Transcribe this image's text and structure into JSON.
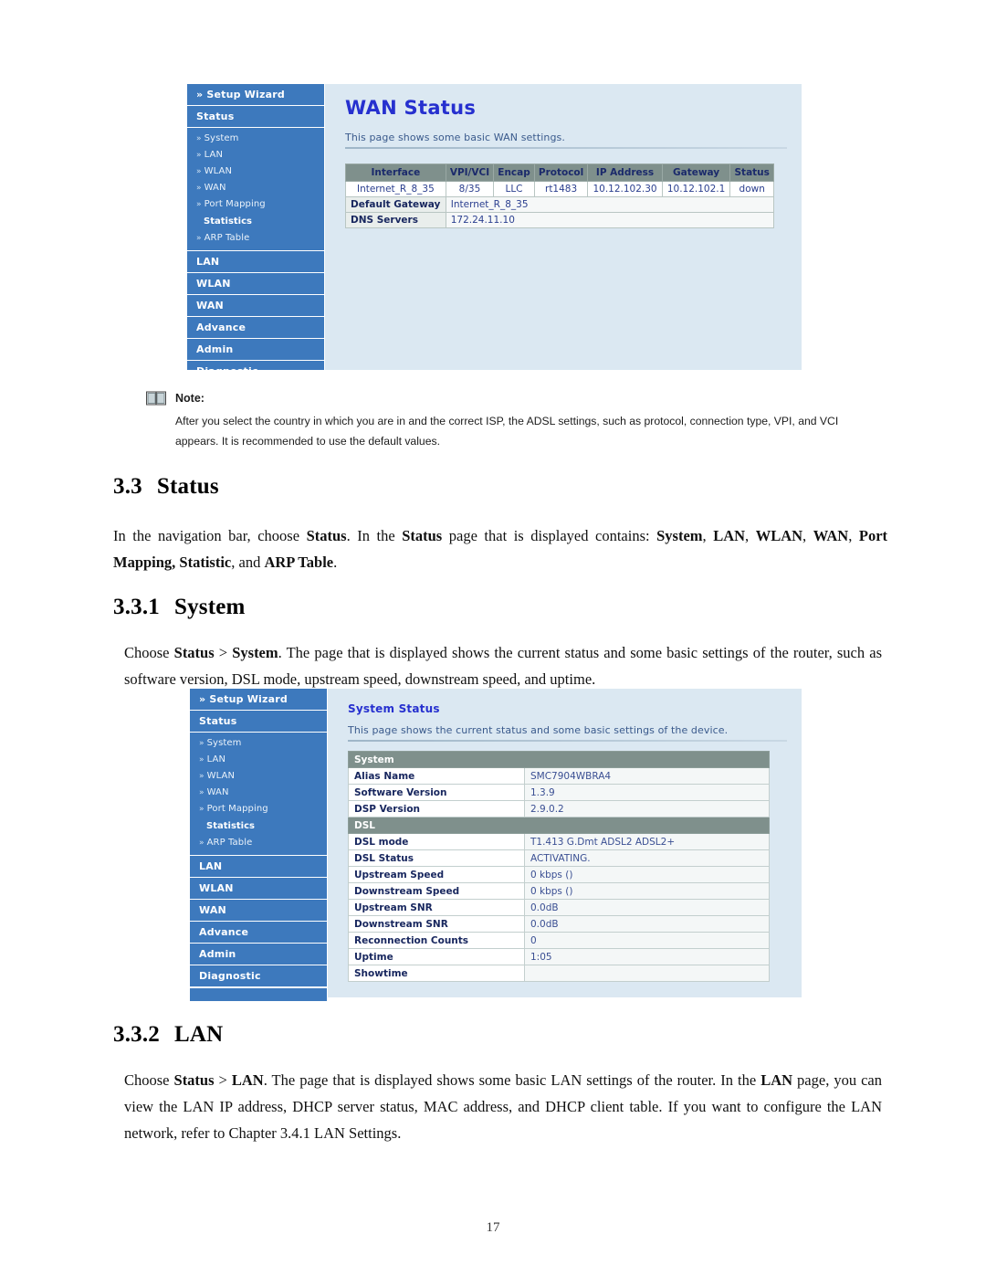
{
  "page": {
    "number": "17"
  },
  "sidebar": {
    "setup_wizard": "Setup Wizard",
    "status": "Status",
    "sub_items": [
      {
        "label": "System",
        "marker": "»"
      },
      {
        "label": "LAN",
        "marker": "»"
      },
      {
        "label": "WLAN",
        "marker": "»"
      },
      {
        "label": "WAN",
        "marker": "»"
      },
      {
        "label": "Port Mapping",
        "marker": "»"
      }
    ],
    "group_label": "Statistics",
    "arp_table": {
      "label": "ARP Table",
      "marker": "»"
    },
    "sections": [
      "LAN",
      "WLAN",
      "WAN",
      "Advance",
      "Admin",
      "Diagnostic"
    ],
    "chevron": "»"
  },
  "wan_panel": {
    "title": "WAN Status",
    "description": "This page shows some basic WAN settings.",
    "table": {
      "headers": [
        "Interface",
        "VPI/VCI",
        "Encap",
        "Protocol",
        "IP Address",
        "Gateway",
        "Status"
      ],
      "rows": [
        [
          "Internet_R_8_35",
          "8/35",
          "LLC",
          "rt1483",
          "10.12.102.30",
          "10.12.102.1",
          "down"
        ]
      ],
      "default_gateway_label": "Default Gateway",
      "default_gateway_value": "Internet_R_8_35",
      "dns_servers_label": "DNS Servers",
      "dns_servers_value": "172.24.11.10"
    }
  },
  "note": {
    "title": "Note:",
    "text": "After you select the country in which you are in and the correct ISP, the ADSL settings, such as protocol, connection type, VPI, and VCI appears. It is recommended to use the default values."
  },
  "section_33": {
    "number": "3.3",
    "title": "Status",
    "paragraph_parts": [
      {
        "t": "In the navigation bar, choose ",
        "b": false
      },
      {
        "t": "Status",
        "b": true
      },
      {
        "t": ". In the ",
        "b": false
      },
      {
        "t": "Status",
        "b": true
      },
      {
        "t": " page that is displayed contains: ",
        "b": false
      },
      {
        "t": "System",
        "b": true
      },
      {
        "t": ", ",
        "b": false
      },
      {
        "t": "LAN",
        "b": true
      },
      {
        "t": ", ",
        "b": false
      },
      {
        "t": "WLAN",
        "b": true
      },
      {
        "t": ", ",
        "b": false
      },
      {
        "t": "WAN",
        "b": true
      },
      {
        "t": ", ",
        "b": false
      },
      {
        "t": "Port Mapping, Statistic",
        "b": true
      },
      {
        "t": ", and ",
        "b": false
      },
      {
        "t": "ARP Table",
        "b": true
      },
      {
        "t": ".",
        "b": false
      }
    ]
  },
  "section_331": {
    "number": "3.3.1",
    "title": "System",
    "paragraph_parts": [
      {
        "t": "Choose ",
        "b": false
      },
      {
        "t": "Status",
        "b": true
      },
      {
        "t": " > ",
        "b": false
      },
      {
        "t": "System",
        "b": true
      },
      {
        "t": ". The page that is displayed shows the current status and some basic settings of the router, such as software version, DSL mode, upstream speed, downstream speed, and uptime.",
        "b": false
      }
    ]
  },
  "system_panel": {
    "title": "System Status",
    "description": "This page shows the current status and some basic settings of the device.",
    "rows": [
      {
        "type": "section",
        "label": "System",
        "value": ""
      },
      {
        "type": "data",
        "label": "Alias Name",
        "value": "SMC7904WBRA4"
      },
      {
        "type": "data",
        "label": "Software Version",
        "value": "1.3.9"
      },
      {
        "type": "data",
        "label": "DSP Version",
        "value": "2.9.0.2"
      },
      {
        "type": "section",
        "label": "DSL",
        "value": ""
      },
      {
        "type": "data",
        "label": "DSL mode",
        "value": "T1.413 G.Dmt ADSL2 ADSL2+"
      },
      {
        "type": "data",
        "label": "DSL Status",
        "value": "ACTIVATING."
      },
      {
        "type": "data",
        "label": "Upstream Speed",
        "value": "0 kbps  ()"
      },
      {
        "type": "data",
        "label": "Downstream Speed",
        "value": "0 kbps  ()"
      },
      {
        "type": "data",
        "label": "Upstream SNR",
        "value": "0.0dB"
      },
      {
        "type": "data",
        "label": "Downstream SNR",
        "value": "0.0dB"
      },
      {
        "type": "data",
        "label": "Reconnection Counts",
        "value": "0"
      },
      {
        "type": "data",
        "label": "Uptime",
        "value": "1:05"
      },
      {
        "type": "data",
        "label": "Showtime",
        "value": ""
      }
    ]
  },
  "section_332": {
    "number": "3.3.2",
    "title": "LAN",
    "paragraph_parts": [
      {
        "t": "Choose ",
        "b": false
      },
      {
        "t": "Status",
        "b": true
      },
      {
        "t": " > ",
        "b": false
      },
      {
        "t": "LAN",
        "b": true
      },
      {
        "t": ". The page that is displayed shows some basic LAN settings of the router. In the ",
        "b": false
      },
      {
        "t": "LAN",
        "b": true
      },
      {
        "t": " page, you can view the LAN IP address, DHCP server status, MAC address, and DHCP client table. If you want to configure the LAN network, refer to Chapter 3.4.1 LAN Settings.",
        "b": false
      }
    ]
  },
  "colors": {
    "sidebar_blue": "#3d79bd",
    "content_bg": "#dbe8f2",
    "title_blue": "#2630cf",
    "table_header": "#7f908c",
    "label_navy": "#17265e"
  }
}
